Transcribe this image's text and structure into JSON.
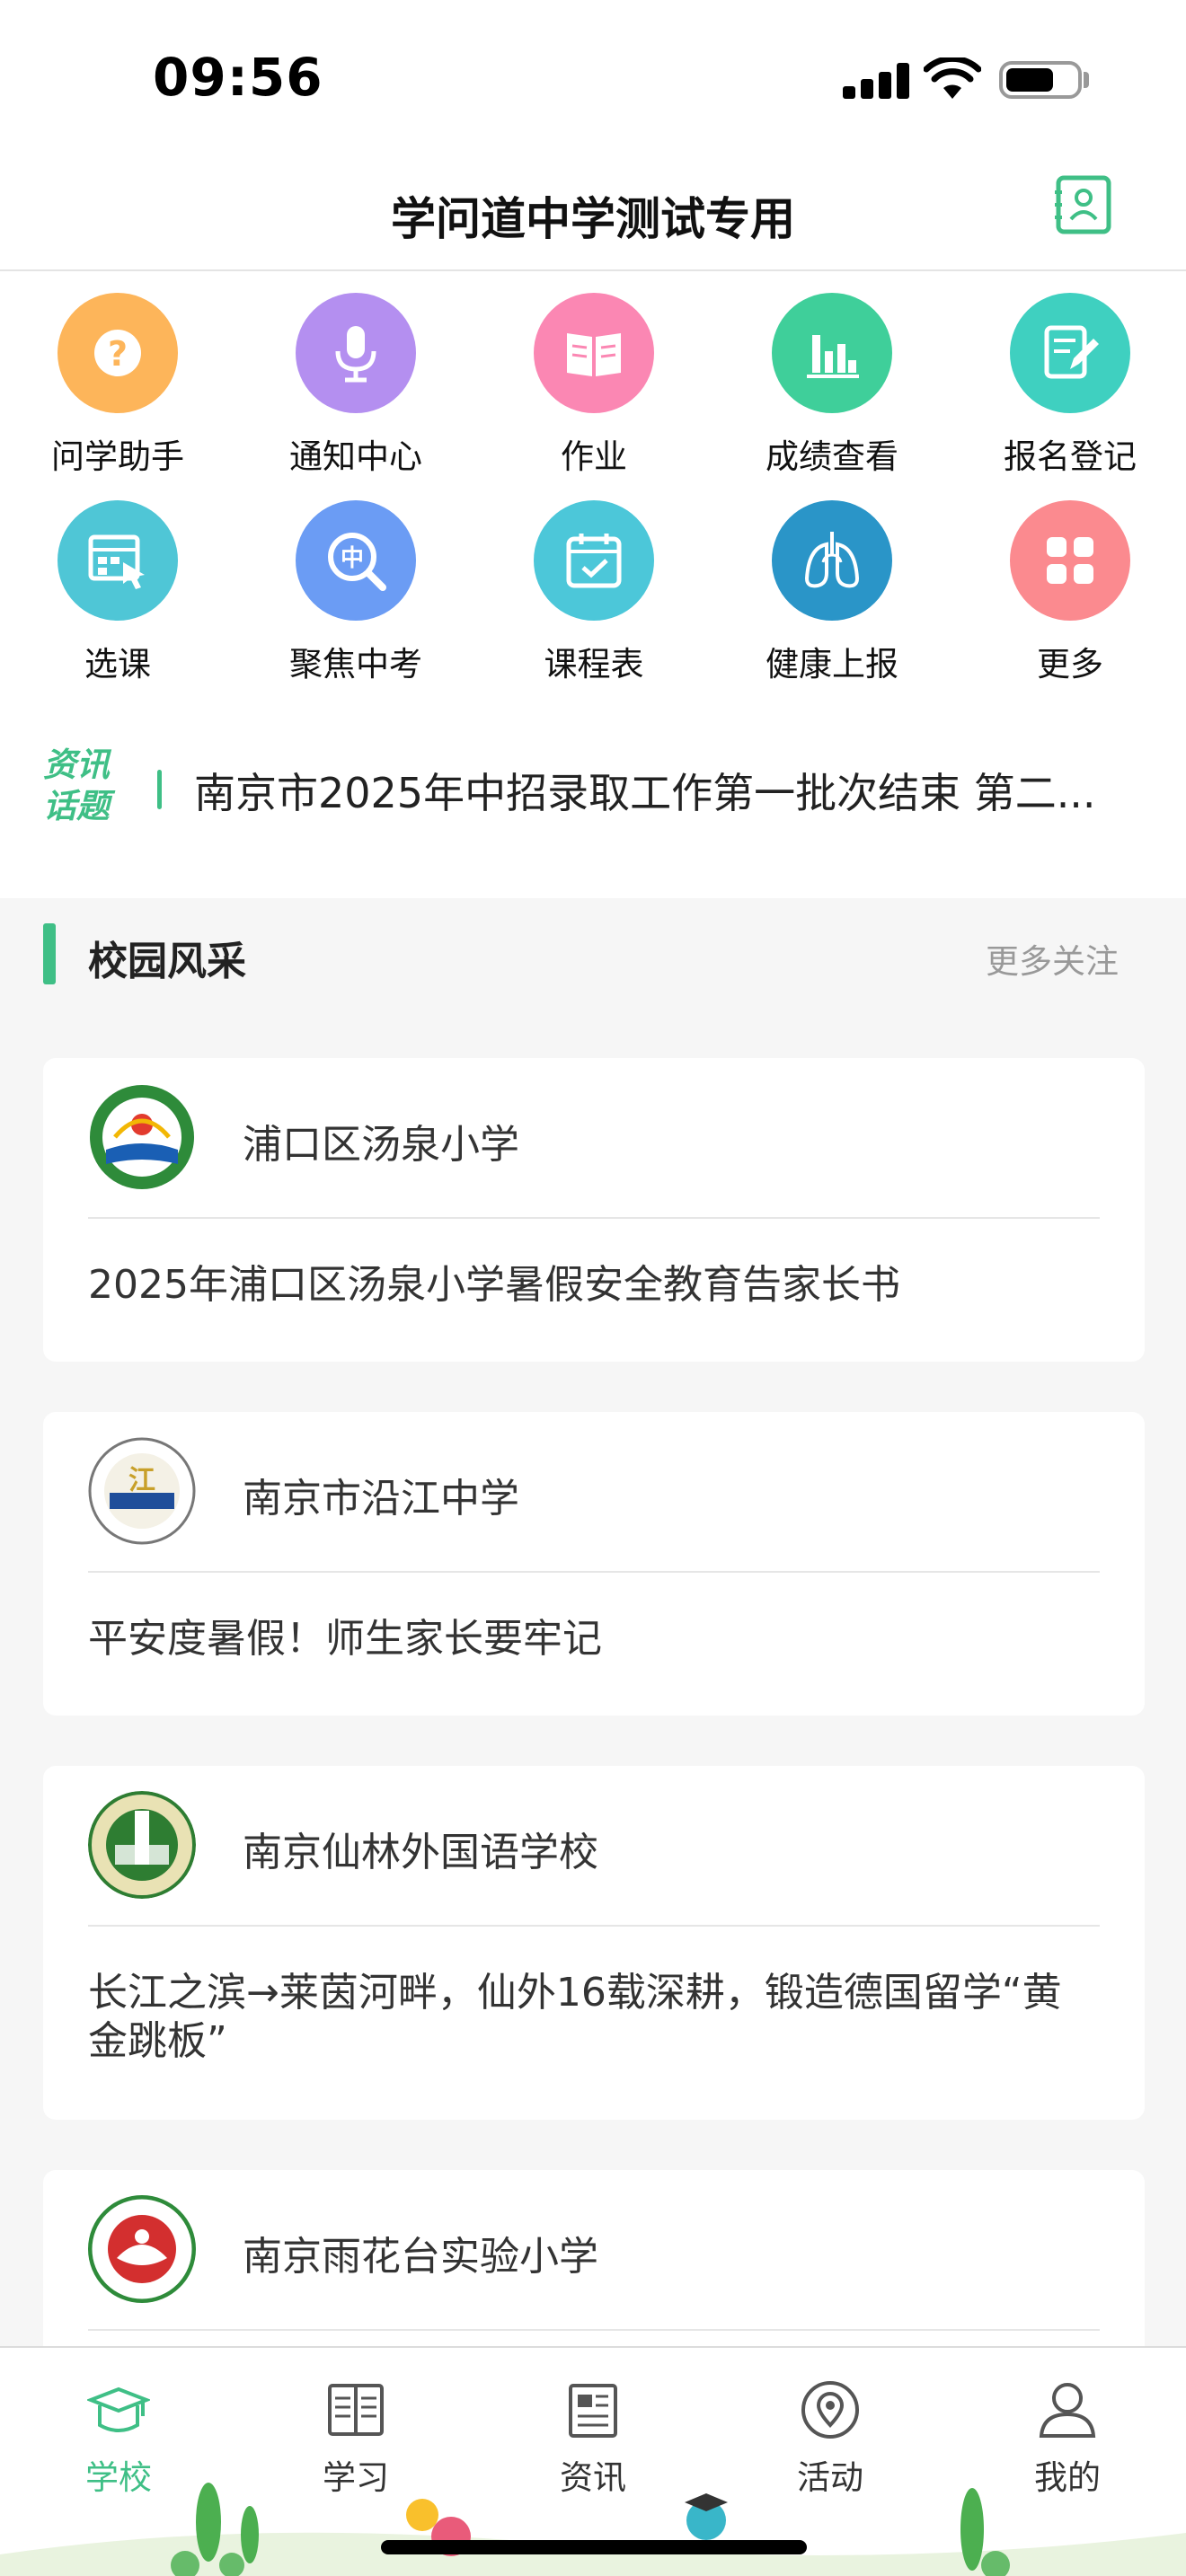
{
  "status": {
    "time": "09:56"
  },
  "header": {
    "title": "学问道中学测试专用"
  },
  "grid": [
    {
      "label": "问学助手",
      "icon": "question-icon",
      "color": "#fdb55a"
    },
    {
      "label": "通知中心",
      "icon": "microphone-icon",
      "color": "#b48ff0"
    },
    {
      "label": "作业",
      "icon": "book-icon",
      "color": "#fb87b3"
    },
    {
      "label": "成绩查看",
      "icon": "bar-chart-icon",
      "color": "#3fcf9a"
    },
    {
      "label": "报名登记",
      "icon": "edit-form-icon",
      "color": "#3fd0c0"
    },
    {
      "label": "选课",
      "icon": "course-select-icon",
      "color": "#4fc6d6"
    },
    {
      "label": "聚焦中考",
      "icon": "search-exam-icon",
      "color": "#6b9cf4"
    },
    {
      "label": "课程表",
      "icon": "calendar-icon",
      "color": "#4cc7d9"
    },
    {
      "label": "健康上报",
      "icon": "lungs-icon",
      "color": "#2a95c8"
    },
    {
      "label": "更多",
      "icon": "grid-more-icon",
      "color": "#fb8a8f"
    }
  ],
  "ticker": {
    "logo_line1": "资讯",
    "logo_line2": "话题",
    "text": "南京市2025年中招录取工作第一批次结束 第二..."
  },
  "section": {
    "title": "校园风采",
    "more": "更多关注"
  },
  "cards": [
    {
      "school": "浦口区汤泉小学",
      "headline": "2025年浦口区汤泉小学暑假安全教育告家长书"
    },
    {
      "school": "南京市沿江中学",
      "headline": "平安度暑假！师生家长要牢记"
    },
    {
      "school": "南京仙林外国语学校",
      "headline": "长江之滨→莱茵河畔，仙外16载深耕，锻造德国留学“黄金跳板”"
    },
    {
      "school": "南京雨花台实验小学",
      "headline": ""
    }
  ],
  "tabs": [
    {
      "label": "学校",
      "icon": "school-cap-icon",
      "active": true
    },
    {
      "label": "学习",
      "icon": "open-book-icon",
      "active": false
    },
    {
      "label": "资讯",
      "icon": "news-icon",
      "active": false
    },
    {
      "label": "活动",
      "icon": "location-pin-icon",
      "active": false
    },
    {
      "label": "我的",
      "icon": "person-icon",
      "active": false
    }
  ],
  "colors": {
    "accent": "#3fbf86"
  }
}
